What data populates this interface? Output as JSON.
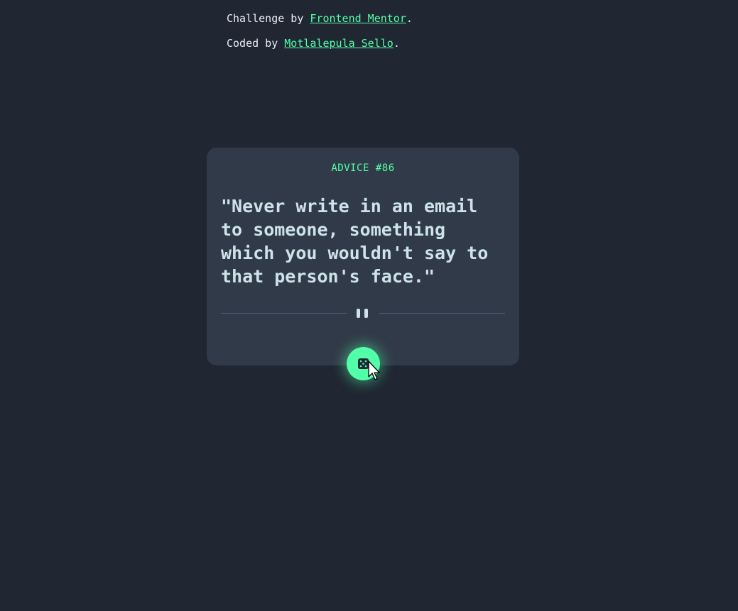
{
  "attribution": {
    "challenge_prefix": "Challenge by ",
    "challenge_link": "Frontend Mentor",
    "challenge_suffix": ".",
    "coded_prefix": "Coded by ",
    "coded_link": "Motlalepula Sello",
    "coded_suffix": "."
  },
  "card": {
    "advice_id": "ADVICE #86",
    "advice_text": "\"Never write in an email to someone, something which you wouldn't say to that person's face.\""
  },
  "icons": {
    "divider": "pause-divider-icon",
    "button": "dice-icon",
    "pointer": "mouse-cursor-icon"
  },
  "colors": {
    "background": "#202632",
    "card": "#313a48",
    "accent": "#52ffa8",
    "text": "#cee3e9"
  }
}
